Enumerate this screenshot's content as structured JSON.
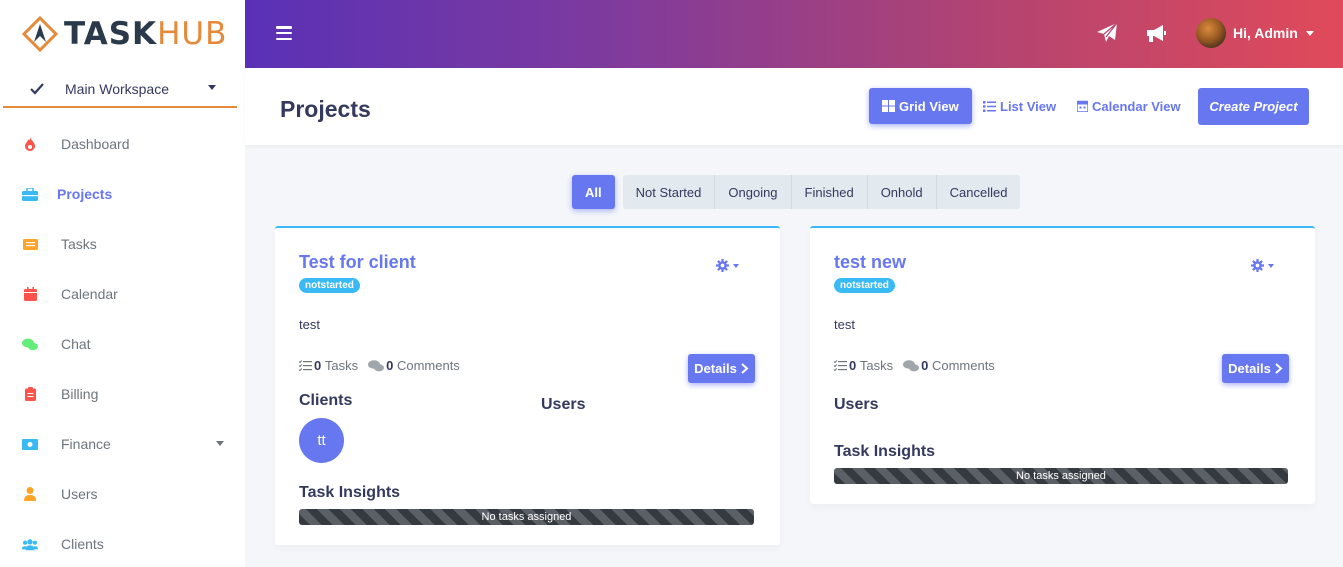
{
  "brand": {
    "part1": "TASK",
    "part2": "HUB"
  },
  "workspace": {
    "label": "Main Workspace"
  },
  "sidebar": {
    "items": [
      {
        "label": "Dashboard",
        "icon": "fire-icon",
        "color": "#fc544b"
      },
      {
        "label": "Projects",
        "icon": "briefcase-icon",
        "color": "#3abaf4"
      },
      {
        "label": "Tasks",
        "icon": "list-icon",
        "color": "#ffa426"
      },
      {
        "label": "Calendar",
        "icon": "calendar-icon",
        "color": "#fc544b"
      },
      {
        "label": "Chat",
        "icon": "chat-icon",
        "color": "#63ed7a"
      },
      {
        "label": "Billing",
        "icon": "clipboard-icon",
        "color": "#fc544b"
      },
      {
        "label": "Finance",
        "icon": "money-icon",
        "color": "#3abaf4"
      },
      {
        "label": "Users",
        "icon": "user-icon",
        "color": "#ffa426"
      },
      {
        "label": "Clients",
        "icon": "users-icon",
        "color": "#3abaf4"
      }
    ]
  },
  "topbar": {
    "greeting": "Hi, Admin"
  },
  "page": {
    "title": "Projects",
    "views": {
      "grid": "Grid View",
      "list": "List View",
      "calendar": "Calendar View"
    },
    "create": "Create Project"
  },
  "filters": {
    "all": "All",
    "not_started": "Not Started",
    "ongoing": "Ongoing",
    "finished": "Finished",
    "onhold": "Onhold",
    "cancelled": "Cancelled"
  },
  "projects": [
    {
      "title": "Test for client",
      "status": "notstarted",
      "description": "test",
      "tasks_count": "0",
      "tasks_label": "Tasks",
      "comments_count": "0",
      "comments_label": "Comments",
      "details": "Details",
      "clients_heading": "Clients",
      "client_initials": "tt",
      "users_heading": "Users",
      "insights_heading": "Task Insights",
      "insights_text": "No tasks assigned"
    },
    {
      "title": "test new",
      "status": "notstarted",
      "description": "test",
      "tasks_count": "0",
      "tasks_label": "Tasks",
      "comments_count": "0",
      "comments_label": "Comments",
      "details": "Details",
      "users_heading": "Users",
      "insights_heading": "Task Insights",
      "insights_text": "No tasks assigned"
    }
  ],
  "colors": {
    "primary": "#6777ef",
    "info": "#3abaf4",
    "accent": "#e58a3a"
  }
}
